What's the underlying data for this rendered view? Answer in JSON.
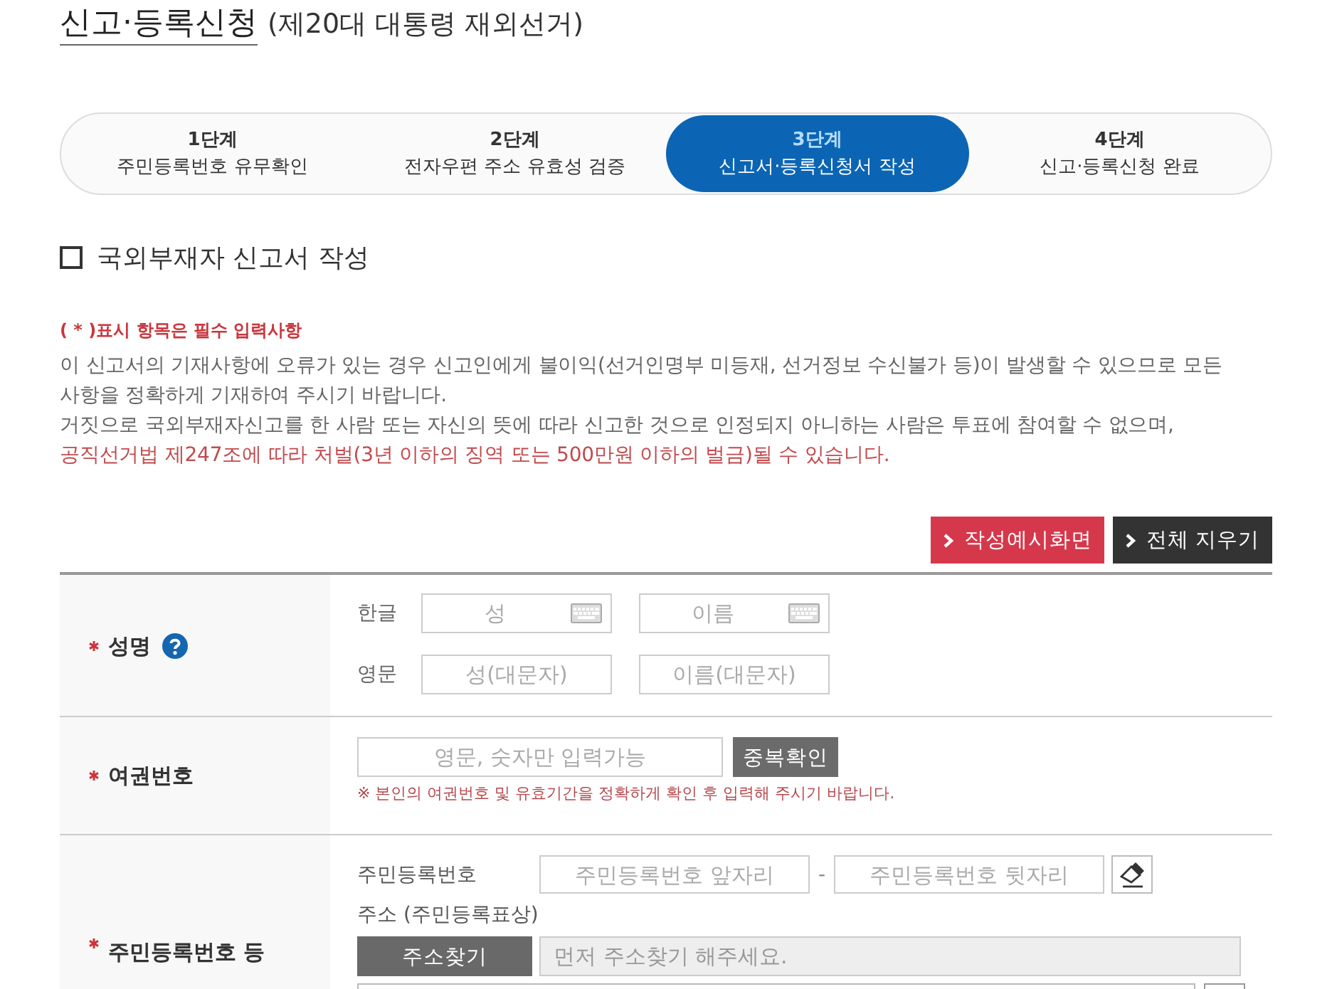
{
  "page_title": {
    "main": "신고·등록신청",
    "sub": "(제20대 대통령 재외선거)"
  },
  "steps": [
    {
      "label": "1단계",
      "description": "주민등록번호 유무확인",
      "selected": false
    },
    {
      "label": "2단계",
      "description": "전자우편 주소 유효성 검증",
      "selected": false
    },
    {
      "label": "3단계",
      "description": "신고서·등록신청서 작성",
      "selected": true
    },
    {
      "label": "4단계",
      "description": "신고·등록신청 완료",
      "selected": false
    }
  ],
  "absentee_option": {
    "label": "국외부재자 신고서 작성",
    "checked": false
  },
  "notice": {
    "required_note": "( * )표시 항목은 필수 입력사항",
    "paragraphs": [
      {
        "kind": "normal",
        "text": "이 신고서의 기재사항에 오류가 있는 경우 신고인에게 불이익(선거인명부 미등재, 선거정보 수신불가 등)이 발생할 수 있으므로 모든 사항을 정확하게 기재하여 주시기 바랍니다."
      },
      {
        "kind": "normal",
        "text": "거짓으로 국외부재자신고를 한 사람 또는 자신의 뜻에 따라 신고한 것으로 인정되지 아니하는 사람은 투표에 참여할 수 없으며,"
      },
      {
        "kind": "warning",
        "text": "공직선거법 제247조에 따라 처벌(3년 이하의 징역 또는 500만원 이하의 벌금)될 수 있습니다."
      }
    ]
  },
  "actions": [
    {
      "kind": "primary",
      "label": "작성예시화면"
    },
    {
      "kind": "dark",
      "label": "전체 지우기"
    }
  ],
  "form": {
    "rows": [
      {
        "kind": "name",
        "label": "성명",
        "required": true,
        "help": true,
        "lines": [
          {
            "label": "한글",
            "fields": [
              {
                "placeholder": "성",
                "keyboard": true
              },
              {
                "placeholder": "이름",
                "keyboard": true
              }
            ]
          },
          {
            "label": "영문",
            "fields": [
              {
                "placeholder": "성(대문자)",
                "keyboard": false
              },
              {
                "placeholder": "이름(대문자)",
                "keyboard": false
              }
            ]
          }
        ]
      },
      {
        "kind": "passport",
        "label": "여권번호",
        "required": true,
        "help": false,
        "field": {
          "placeholder": "영문, 숫자만 입력가능"
        },
        "button": "중복확인",
        "note": "※ 본인의 여권번호 및 유효기간을 정확하게 확인 후 입력해 주시기 바랍니다."
      },
      {
        "kind": "resident",
        "label": "주민등록번호 등",
        "required": true,
        "help": false,
        "id_label": "주민등록번호",
        "id_fields": [
          {
            "placeholder": "주민등록번호 앞자리"
          },
          {
            "placeholder": "주민등록번호 뒷자리"
          }
        ],
        "separator": "-",
        "address_label": "주소 (주민등록표상)",
        "address_button": "주소찾기",
        "address_field": {
          "placeholder": "먼저 주소찾기 해주세요.",
          "disabled": true
        },
        "address_detail": {
          "fields": [
            {
              "kind": "text"
            },
            {
              "kind": "button"
            }
          ]
        }
      }
    ]
  }
}
